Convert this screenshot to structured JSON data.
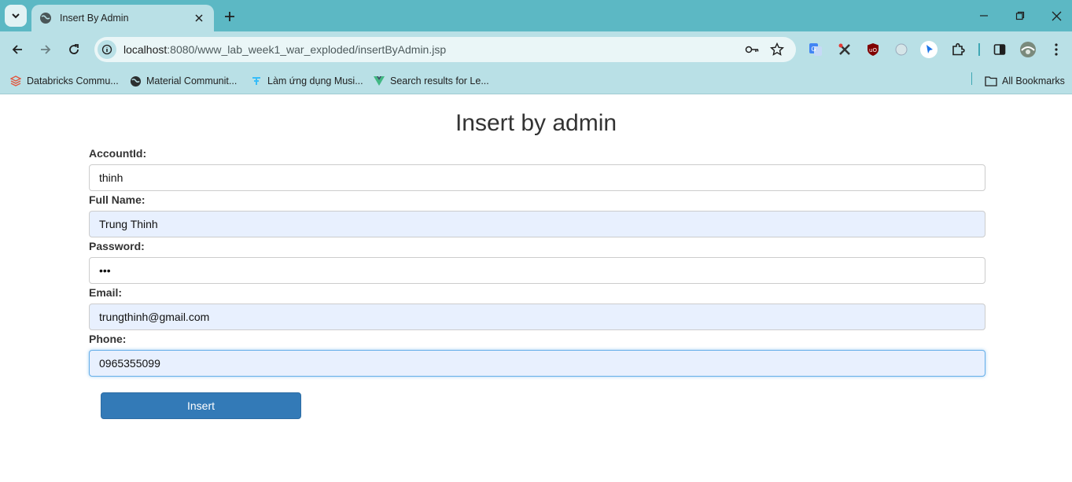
{
  "browser": {
    "tab_title": "Insert By Admin",
    "url_host": "localhost",
    "url_rest": ":8080/www_lab_week1_war_exploded/insertByAdmin.jsp",
    "bookmarks": [
      {
        "label": "Databricks Commu...",
        "icon": "databricks-icon"
      },
      {
        "label": "Material Communit...",
        "icon": "globe-icon"
      },
      {
        "label": "Làm ứng dụng Musi...",
        "icon": "tailwind-icon"
      },
      {
        "label": "Search results for Le...",
        "icon": "vue-icon"
      }
    ],
    "all_bookmarks_label": "All Bookmarks"
  },
  "page": {
    "title": "Insert by admin",
    "fields": [
      {
        "label": "AccountId:",
        "value": "thinh"
      },
      {
        "label": "Full Name:",
        "value": "Trung Thinh"
      },
      {
        "label": "Password:",
        "value": "•••"
      },
      {
        "label": "Email:",
        "value": "trungthinh@gmail.com"
      },
      {
        "label": "Phone:",
        "value": "0965355099"
      }
    ],
    "submit_label": "Insert"
  },
  "colors": {
    "chrome": "#5cb8c4",
    "toolbar": "#b9e0e6",
    "primary_button": "#337ab7",
    "autofill": "#e8f0fe"
  }
}
